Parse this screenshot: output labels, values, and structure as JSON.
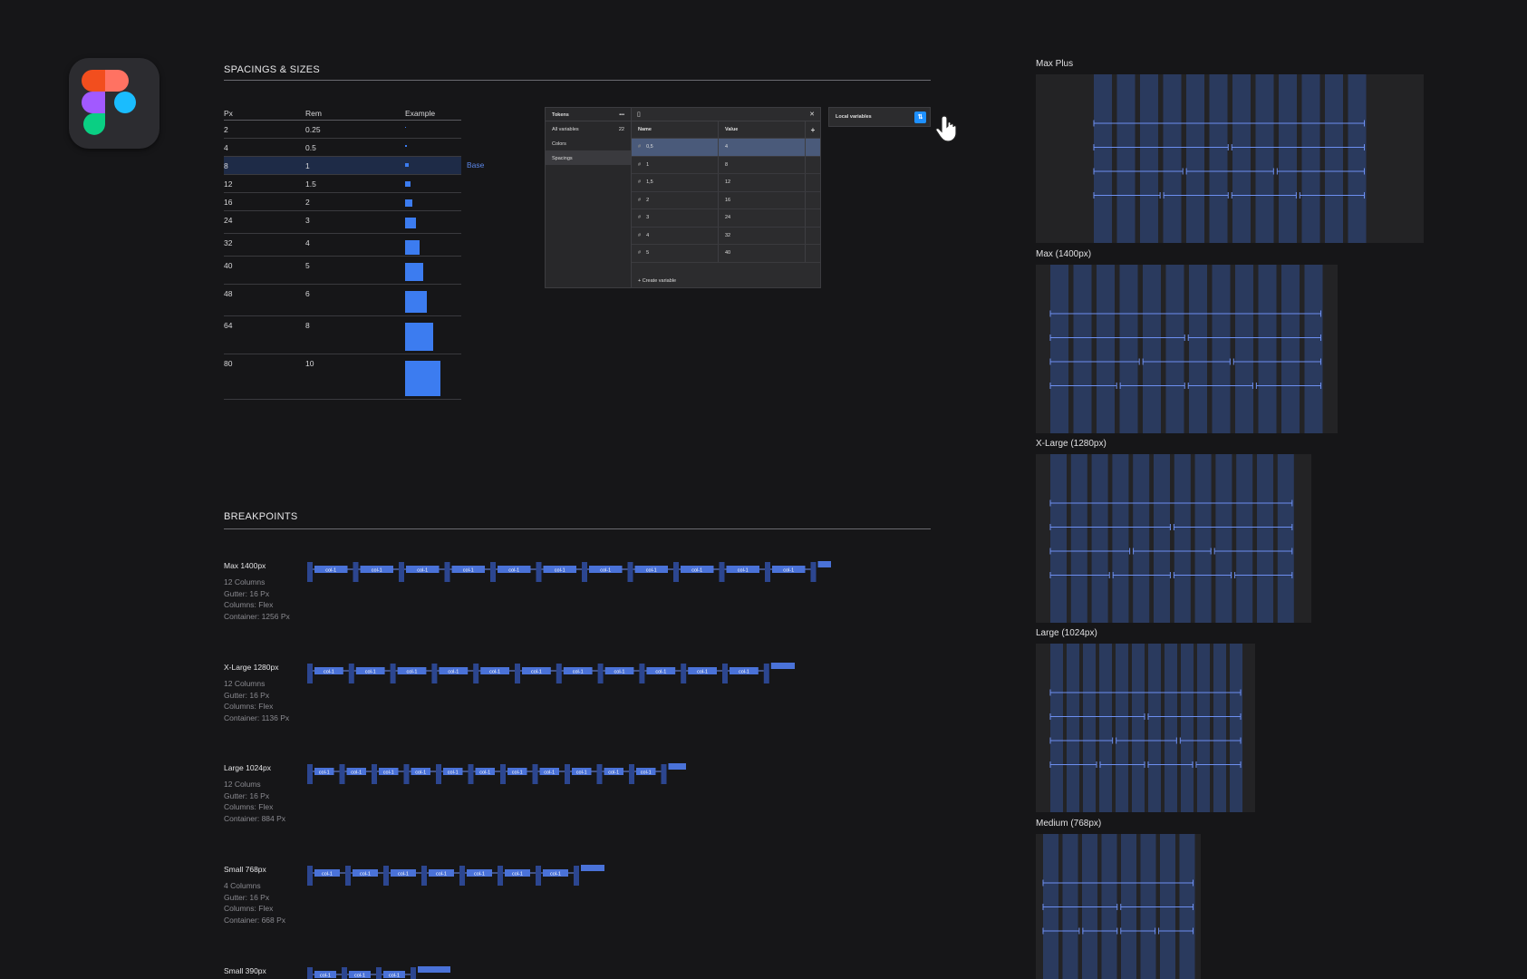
{
  "app": {
    "logo": "figma-logo"
  },
  "colors": {
    "accent": "#3c7cf0",
    "column": "#2a3a5e",
    "line": "#6d8ff0",
    "bg": "#161618"
  },
  "spacings": {
    "title": "SPACINGS & SIZES",
    "headers": [
      "Px",
      "Rem",
      "Example"
    ],
    "base_label": "Base",
    "rows": [
      {
        "px": "2",
        "rem": "0.25"
      },
      {
        "px": "4",
        "rem": "0.5"
      },
      {
        "px": "8",
        "rem": "1"
      },
      {
        "px": "12",
        "rem": "1.5"
      },
      {
        "px": "16",
        "rem": "2"
      },
      {
        "px": "24",
        "rem": "3"
      },
      {
        "px": "32",
        "rem": "4"
      },
      {
        "px": "40",
        "rem": "5"
      },
      {
        "px": "48",
        "rem": "6"
      },
      {
        "px": "64",
        "rem": "8"
      },
      {
        "px": "80",
        "rem": "10"
      }
    ]
  },
  "tokens_panel": {
    "title": "Tokens",
    "collections": [
      {
        "label": "All variables",
        "count": "22"
      },
      {
        "label": "Colors",
        "count": ""
      },
      {
        "label": "Spacings",
        "count": ""
      }
    ],
    "col_name": "Name",
    "col_value": "Value",
    "rows": [
      {
        "name": "0,5",
        "value": "4"
      },
      {
        "name": "1",
        "value": "8"
      },
      {
        "name": "1,5",
        "value": "12"
      },
      {
        "name": "2",
        "value": "16"
      },
      {
        "name": "3",
        "value": "24"
      },
      {
        "name": "4",
        "value": "32"
      },
      {
        "name": "5",
        "value": "40"
      }
    ],
    "create_label": "Create variable",
    "local_variables": "Local variables"
  },
  "breakpoints": {
    "title": "BREAKPOINTS",
    "col_label": "col-1",
    "items": [
      {
        "name": "Max 1400px",
        "meta": [
          "12 Columns",
          "Gutter: 16 Px",
          "Columns: Flex",
          "Container: 1256 Px"
        ]
      },
      {
        "name": "X-Large 1280px",
        "meta": [
          "12 Columns",
          "Gutter: 16 Px",
          "Columns: Flex",
          "Container: 1136 Px"
        ]
      },
      {
        "name": "Large 1024px",
        "meta": [
          "12 Colums",
          "Gutter: 16 Px",
          "Columns: Flex",
          "Container: 884 Px"
        ]
      },
      {
        "name": "Small 768px",
        "meta": [
          "4 Columns",
          "Gutter: 16 Px",
          "Columns: Flex",
          "Container: 668 Px"
        ]
      },
      {
        "name": "Small 390px",
        "meta": []
      }
    ]
  },
  "grid_previews": [
    {
      "label": "Max Plus"
    },
    {
      "label": "Max (1400px)"
    },
    {
      "label": "X-Large (1280px)"
    },
    {
      "label": "Large (1024px)"
    },
    {
      "label": "Medium (768px)"
    }
  ]
}
